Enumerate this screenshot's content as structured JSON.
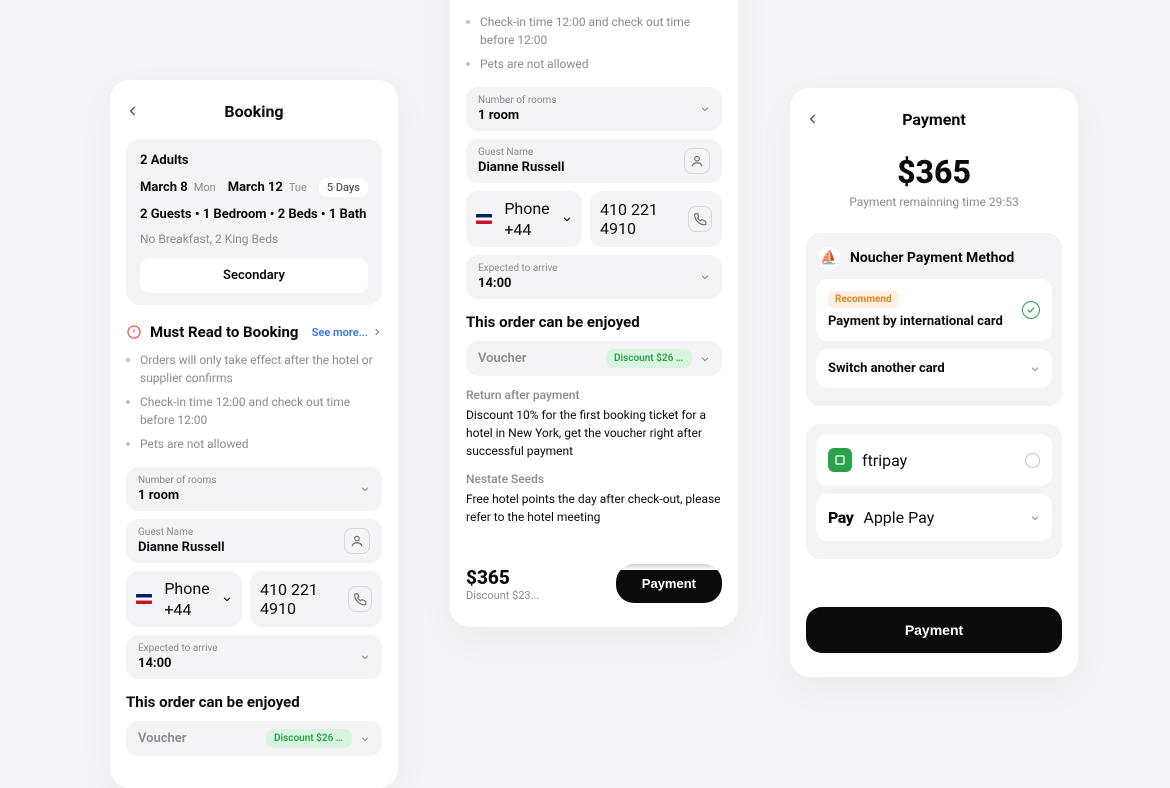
{
  "booking": {
    "title": "Booking",
    "adults": "2 Adults",
    "date_from": "March 8",
    "date_from_dow": "Mon",
    "date_to": "March 12",
    "date_to_dow": "Tue",
    "stay_len": "5 Days",
    "composition": "2 Guests • 1 Bedroom • 2 Beds • 1 Bath",
    "extras": "No Breakfast, 2 King Beds",
    "secondary_btn": "Secondary",
    "must_read": "Must Read to Booking",
    "see_more": "See more...",
    "rules": [
      "Orders will only take effect after the hotel or supplier confirms",
      "Check-in time 12:00 and check out time before 12:00",
      "Pets are not allowed"
    ],
    "fields": {
      "rooms_label": "Number of rooms",
      "rooms_value": "1 room",
      "guest_label": "Guest Name",
      "guest_value": "Dianne Russell",
      "phone_label": "Phone",
      "phone_cc": "+44",
      "phone_number": "410 221 4910",
      "arrive_label": "Expected to arrive",
      "arrive_value": "14:00"
    },
    "enjoy_title": "This order can be enjoyed",
    "voucher_label": "Voucher",
    "voucher_badge": "Discount $26 for ...",
    "return_head": "Return after payment",
    "return_body": "Discount 10% for the first booking ticket for a hotel in New York, get the voucher right after successful payment",
    "seeds_head": "Nestate Seeds",
    "seeds_body": "Free hotel points the day after check-out, please refer to the hotel meeting",
    "price": "$365",
    "discount": "Discount $23...",
    "pay_btn": "Payment"
  },
  "payment": {
    "title": "Payment",
    "amount": "$365",
    "remain": "Payment remainning time 29:53",
    "noucher_title": "Noucher Payment Method",
    "recommend": "Recommend",
    "intl_card": "Payment by international card",
    "switch": "Switch another card",
    "ftripay": "ftripay",
    "apple": "Apple Pay",
    "pay_btn": "Payment"
  }
}
